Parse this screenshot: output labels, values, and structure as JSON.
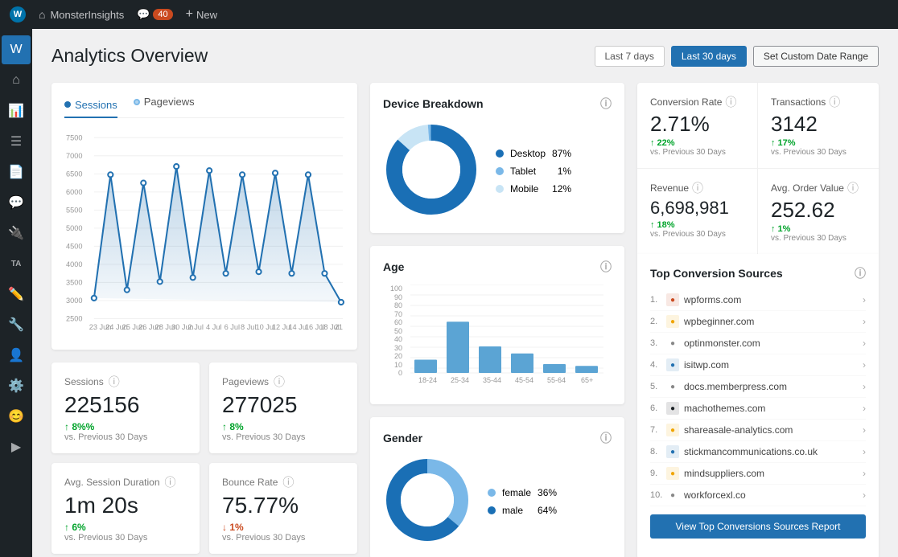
{
  "topnav": {
    "site_name": "MonsterInsights",
    "comments_count": "40",
    "new_label": "New"
  },
  "header": {
    "title": "Analytics Overview",
    "btn_last7": "Last 7 days",
    "btn_last30": "Last 30 days",
    "btn_custom": "Set Custom Date Range"
  },
  "chart": {
    "tab_sessions": "Sessions",
    "tab_pageviews": "Pageviews",
    "y_labels": [
      "7500",
      "7000",
      "6500",
      "6000",
      "5500",
      "5000",
      "4500",
      "4000",
      "3500",
      "3000",
      "2500"
    ],
    "x_labels": [
      "23 Jun",
      "24 Jun",
      "25 Jun",
      "26 Jun",
      "28 Jun",
      "30 Jun",
      "2 Jul",
      "4 Jul",
      "6 Jul",
      "8 Jul",
      "10 Jul",
      "12 Jul",
      "14 Jul",
      "16 Jul",
      "18 Jul",
      "21 Jul"
    ]
  },
  "stats": {
    "sessions_label": "Sessions",
    "sessions_value": "225156",
    "sessions_change": "↑ 8%%",
    "sessions_prev": "vs. Previous 30 Days",
    "pageviews_label": "Pageviews",
    "pageviews_value": "277025",
    "pageviews_change": "↑ 8%",
    "pageviews_prev": "vs. Previous 30 Days",
    "avg_session_label": "Avg. Session Duration",
    "avg_session_value": "1m 20s",
    "avg_session_change": "↑ 6%",
    "avg_session_prev": "vs. Previous 30 Days",
    "bounce_label": "Bounce Rate",
    "bounce_value": "75.77%",
    "bounce_change": "↓ 1%",
    "bounce_prev": "vs. Previous 30 Days"
  },
  "device_breakdown": {
    "title": "Device Breakdown",
    "desktop_label": "Desktop",
    "desktop_pct": "87%",
    "tablet_label": "Tablet",
    "tablet_pct": "1%",
    "mobile_label": "Mobile",
    "mobile_pct": "12%",
    "colors": {
      "desktop": "#1a6fb5",
      "tablet": "#7ab8e8",
      "mobile": "#c8e4f5"
    }
  },
  "age": {
    "title": "Age",
    "groups": [
      "18-24",
      "25-34",
      "35-44",
      "45-54",
      "55-64",
      "65+"
    ],
    "values": [
      15,
      58,
      30,
      22,
      10,
      8
    ],
    "max": 100,
    "y_labels": [
      "100",
      "90",
      "80",
      "70",
      "60",
      "50",
      "40",
      "30",
      "20",
      "10",
      "0"
    ]
  },
  "gender": {
    "title": "Gender",
    "female_label": "female",
    "female_pct": "36%",
    "male_label": "male",
    "male_pct": "64%",
    "colors": {
      "female": "#7ab8e8",
      "male": "#1a6fb5"
    }
  },
  "metrics": {
    "conversion_rate_label": "Conversion Rate",
    "conversion_rate_value": "2.71%",
    "conversion_rate_change": "↑ 22%",
    "conversion_rate_prev": "vs. Previous 30 Days",
    "transactions_label": "Transactions",
    "transactions_value": "3142",
    "transactions_change": "↑ 17%",
    "transactions_prev": "vs. Previous 30 Days",
    "revenue_label": "Revenue",
    "revenue_value": "6,698,981",
    "revenue_change": "↑ 18%",
    "revenue_prev": "vs. Previous 30 Days",
    "avg_order_label": "Avg. Order Value",
    "avg_order_value": "252.62",
    "avg_order_change": "↑ 1%",
    "avg_order_prev": "vs. Previous 30 Days"
  },
  "sources": {
    "title": "Top Conversion Sources",
    "items": [
      {
        "num": "1.",
        "name": "wpforms.com",
        "color": "#ca4a1f"
      },
      {
        "num": "2.",
        "name": "wpbeginner.com",
        "color": "#f0a500"
      },
      {
        "num": "3.",
        "name": "optinmonster.com",
        "color": "#888"
      },
      {
        "num": "4.",
        "name": "isitwp.com",
        "color": "#2271b1"
      },
      {
        "num": "5.",
        "name": "docs.memberpress.com",
        "color": "#888"
      },
      {
        "num": "6.",
        "name": "machothemes.com",
        "color": "#1d2327"
      },
      {
        "num": "7.",
        "name": "shareasale-analytics.com",
        "color": "#f0a500"
      },
      {
        "num": "8.",
        "name": "stickmancommunications.co.uk",
        "color": "#2271b1"
      },
      {
        "num": "9.",
        "name": "mindsuppliers.com",
        "color": "#f0a500"
      },
      {
        "num": "10.",
        "name": "workforcexl.co",
        "color": "#888"
      }
    ],
    "view_report_btn": "View Top Conversions Sources Report"
  }
}
